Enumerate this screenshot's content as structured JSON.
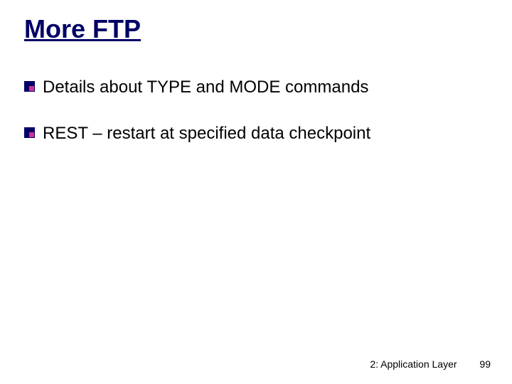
{
  "title": "More FTP",
  "bullets": [
    "Details about TYPE and MODE commands",
    "REST – restart at specified data checkpoint"
  ],
  "footer": {
    "chapter": "2: Application Layer",
    "page": "99"
  }
}
